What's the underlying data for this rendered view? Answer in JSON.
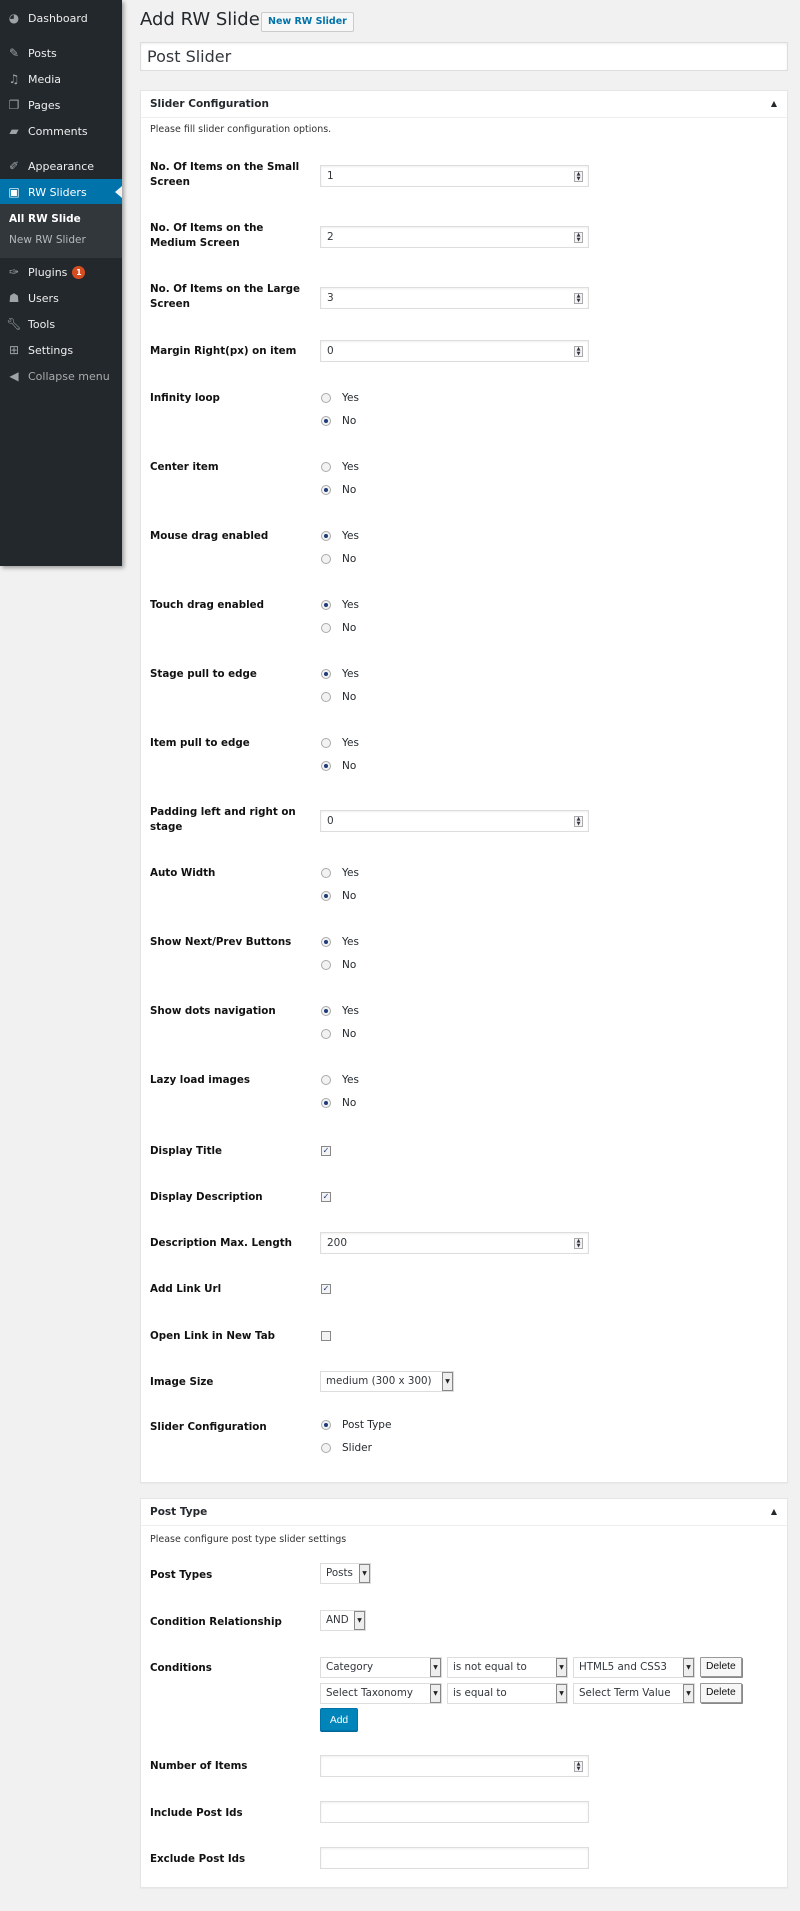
{
  "sidebar": {
    "items": [
      {
        "label": "Dashboard",
        "icon": "dashboard-icon"
      },
      {
        "label": "Posts",
        "icon": "pin-icon"
      },
      {
        "label": "Media",
        "icon": "media-icon"
      },
      {
        "label": "Pages",
        "icon": "pages-icon"
      },
      {
        "label": "Comments",
        "icon": "comment-icon"
      },
      {
        "label": "Appearance",
        "icon": "brush-icon"
      },
      {
        "label": "RW Sliders",
        "icon": "slider-icon"
      },
      {
        "label": "Plugins",
        "icon": "plugin-icon",
        "badge": "1"
      },
      {
        "label": "Users",
        "icon": "user-icon"
      },
      {
        "label": "Tools",
        "icon": "wrench-icon"
      },
      {
        "label": "Settings",
        "icon": "settings-icon"
      },
      {
        "label": "Collapse menu",
        "icon": "collapse-icon"
      }
    ],
    "submenu": [
      {
        "label": "All RW Slide",
        "current": true
      },
      {
        "label": "New RW Slider",
        "current": false
      }
    ]
  },
  "header": {
    "title": "Add RW Slider",
    "new_button": "New RW Slider",
    "title_value": "Post Slider"
  },
  "slider_config": {
    "title": "Slider Configuration",
    "description": "Please fill slider configuration options.",
    "small_screen": {
      "label": "No. Of Items on the Small Screen",
      "value": "1"
    },
    "medium_screen": {
      "label": "No. Of Items on the Medium Screen",
      "value": "2"
    },
    "large_screen": {
      "label": "No. Of Items on the Large Screen",
      "value": "3"
    },
    "margin_right": {
      "label": "Margin Right(px) on item",
      "value": "0"
    },
    "infinity_loop": {
      "label": "Infinity loop",
      "yes": "Yes",
      "no": "No",
      "selected": "No"
    },
    "center_item": {
      "label": "Center item",
      "yes": "Yes",
      "no": "No",
      "selected": "No"
    },
    "mouse_drag": {
      "label": "Mouse drag enabled",
      "yes": "Yes",
      "no": "No",
      "selected": "Yes"
    },
    "touch_drag": {
      "label": "Touch drag enabled",
      "yes": "Yes",
      "no": "No",
      "selected": "Yes"
    },
    "stage_pull": {
      "label": "Stage pull to edge",
      "yes": "Yes",
      "no": "No",
      "selected": "Yes"
    },
    "item_pull": {
      "label": "Item pull to edge",
      "yes": "Yes",
      "no": "No",
      "selected": "No"
    },
    "stage_padding": {
      "label": "Padding left and right on stage",
      "value": "0"
    },
    "auto_width": {
      "label": "Auto Width",
      "yes": "Yes",
      "no": "No",
      "selected": "No"
    },
    "nav_buttons": {
      "label": "Show Next/Prev Buttons",
      "yes": "Yes",
      "no": "No",
      "selected": "Yes"
    },
    "dots_nav": {
      "label": "Show dots navigation",
      "yes": "Yes",
      "no": "No",
      "selected": "Yes"
    },
    "lazy_load": {
      "label": "Lazy load images",
      "yes": "Yes",
      "no": "No",
      "selected": "No"
    },
    "display_title": {
      "label": "Display Title",
      "checked": true
    },
    "display_description": {
      "label": "Display Description",
      "checked": true
    },
    "description_max": {
      "label": "Description Max. Length",
      "value": "200"
    },
    "add_link": {
      "label": "Add Link Url",
      "checked": true
    },
    "open_new_tab": {
      "label": "Open Link in New Tab",
      "checked": false
    },
    "image_size": {
      "label": "Image Size",
      "value": "medium (300 x 300)"
    },
    "slider_source": {
      "label": "Slider Configuration",
      "option1": "Post Type",
      "option2": "Slider",
      "selected": "Post Type"
    }
  },
  "post_type": {
    "title": "Post Type",
    "description": "Please configure post type slider settings",
    "post_types": {
      "label": "Post Types",
      "value": "Posts"
    },
    "condition_relationship": {
      "label": "Condition Relationship",
      "value": "AND"
    },
    "conditions": {
      "label": "Conditions",
      "rows": [
        {
          "taxonomy": "Category",
          "operator": "is not equal to",
          "term": "HTML5 and CSS3",
          "delete": "Delete"
        },
        {
          "taxonomy": "Select Taxonomy",
          "operator": "is equal to",
          "term": "Select Term Value",
          "delete": "Delete"
        }
      ],
      "add": "Add"
    },
    "number_of_items": {
      "label": "Number of Items",
      "value": ""
    },
    "include_ids": {
      "label": "Include Post Ids",
      "value": ""
    },
    "exclude_ids": {
      "label": "Exclude Post Ids",
      "value": ""
    }
  },
  "colors": {
    "sidebar_bg": "#23282d",
    "active": "#0073aa",
    "badge": "#d54e21",
    "primary_button": "#0085ba"
  }
}
